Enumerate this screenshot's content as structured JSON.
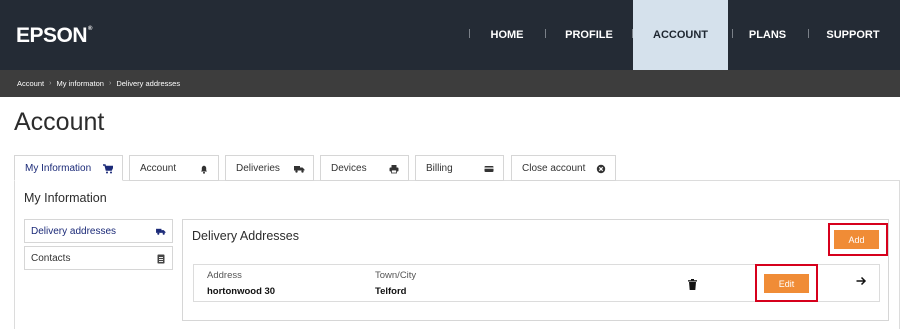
{
  "header": {
    "logo": "EPSON",
    "logo_mark": "®",
    "nav": [
      "HOME",
      "PROFILE",
      "ACCOUNT",
      "PLANS",
      "SUPPORT"
    ],
    "active_nav": "ACCOUNT"
  },
  "breadcrumb": [
    "Account",
    "My informaton",
    "Delivery addresses"
  ],
  "page_title": "Account",
  "tabs": [
    {
      "label": "My Information",
      "icon": "cart-icon"
    },
    {
      "label": "Account",
      "icon": "bell-icon"
    },
    {
      "label": "Deliveries",
      "icon": "truck-icon"
    },
    {
      "label": "Devices",
      "icon": "printer-icon"
    },
    {
      "label": "Billing",
      "icon": "card-icon"
    },
    {
      "label": "Close account",
      "icon": "close-circle-icon"
    }
  ],
  "section_title": "My Information",
  "side_menu": [
    {
      "label": "Delivery addresses",
      "icon": "truck-icon"
    },
    {
      "label": "Contacts",
      "icon": "contact-card-icon"
    }
  ],
  "delivery": {
    "title": "Delivery Addresses",
    "add_label": "Add",
    "address_label": "Address",
    "address_value": "hortonwood 30",
    "town_label": "Town/City",
    "town_value": "Telford",
    "edit_label": "Edit"
  },
  "colors": {
    "header_bg": "#242b35",
    "active_nav_bg": "#d5e1ec",
    "breadcrumb_bg": "#3d3d3d",
    "accent_orange": "#f08c36",
    "highlight_red": "#d6001c",
    "active_tab_text": "#1b2a78"
  }
}
